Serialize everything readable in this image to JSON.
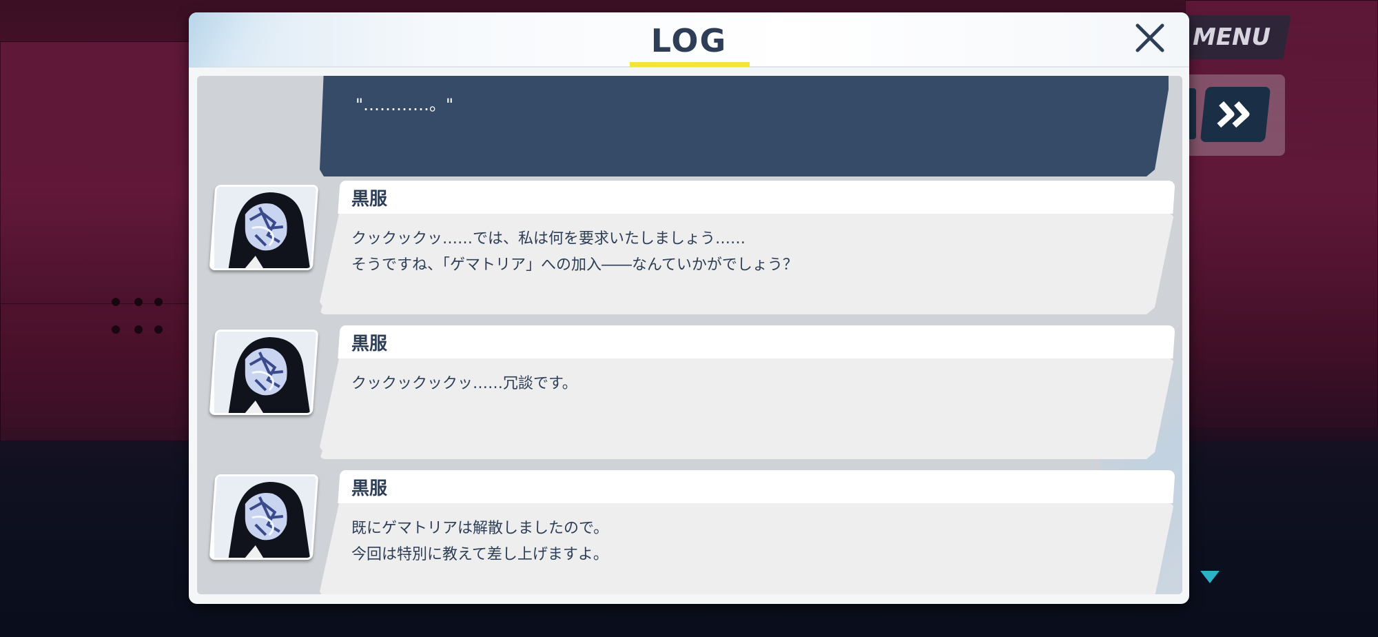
{
  "hud": {
    "menu_label": "MENU",
    "fast_forward_icon": "double-chevron-right-icon",
    "scroll_indicator_icon": "triangle-down-icon"
  },
  "dialog": {
    "title": "LOG",
    "close_icon": "close-icon",
    "accent_color": "#f5e23a",
    "previous_message": {
      "text": "\"…………。\""
    },
    "entries": [
      {
        "speaker": "黒服",
        "line1": "クックックッ……では、私は何を要求いたしましょう……",
        "line2": "そうですね、「ゲマトリア」への加入――なんていかがでしょう？"
      },
      {
        "speaker": "黒服",
        "line1": "クックックックッ……冗談です。",
        "line2": ""
      },
      {
        "speaker": "黒服",
        "line1": "既にゲマトリアは解散しましたので。",
        "line2": "今回は特別に教えて差し上げますよ。"
      }
    ]
  }
}
